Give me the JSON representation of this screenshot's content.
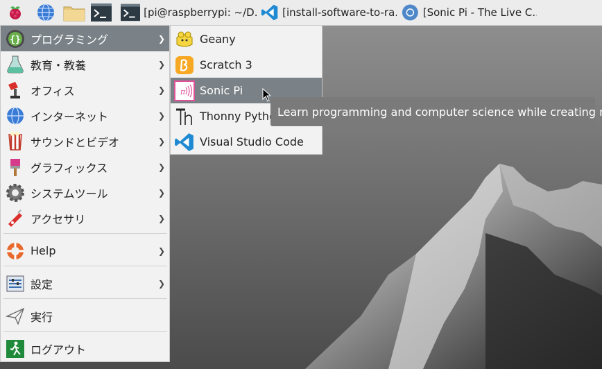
{
  "taskbar": {
    "tasks": [
      {
        "label": "[pi@raspberrypi: ~/D...",
        "icon": "terminal-icon"
      },
      {
        "label": "[install-software-to-ra...",
        "icon": "vscode-icon"
      },
      {
        "label": "[Sonic Pi - The Live C...",
        "icon": "chromium-icon"
      }
    ]
  },
  "menu": {
    "items": [
      {
        "label": "プログラミング",
        "icon": "programming-icon",
        "has_submenu": true
      },
      {
        "label": "教育・教養",
        "icon": "education-icon",
        "has_submenu": true
      },
      {
        "label": "オフィス",
        "icon": "office-icon",
        "has_submenu": true
      },
      {
        "label": "インターネット",
        "icon": "internet-icon",
        "has_submenu": true
      },
      {
        "label": "サウンドとビデオ",
        "icon": "sound-video-icon",
        "has_submenu": true
      },
      {
        "label": "グラフィックス",
        "icon": "graphics-icon",
        "has_submenu": true
      },
      {
        "label": "システムツール",
        "icon": "system-tools-icon",
        "has_submenu": true
      },
      {
        "label": "アクセサリ",
        "icon": "accessories-icon",
        "has_submenu": true
      },
      {
        "label": "Help",
        "icon": "help-icon",
        "has_submenu": true
      },
      {
        "label": "設定",
        "icon": "settings-icon",
        "has_submenu": true
      },
      {
        "label": "実行",
        "icon": "run-icon",
        "has_submenu": false
      },
      {
        "label": "ログアウト",
        "icon": "logout-icon",
        "has_submenu": false
      }
    ]
  },
  "submenu": {
    "items": [
      {
        "label": "Geany",
        "icon": "geany-icon"
      },
      {
        "label": "Scratch 3",
        "icon": "scratch-icon"
      },
      {
        "label": "Sonic Pi",
        "icon": "sonic-pi-icon"
      },
      {
        "label": "Thonny Python",
        "icon": "thonny-icon"
      },
      {
        "label": "Visual Studio Code",
        "icon": "vscode-icon"
      }
    ]
  },
  "tooltip": {
    "text": "Learn programming and computer science while creating music"
  },
  "colors": {
    "menu_bg": "#f2f2f2",
    "highlight": "#7b8287",
    "taskbar_bg": "#ececec",
    "tooltip_bg": "#7a7a7a"
  }
}
